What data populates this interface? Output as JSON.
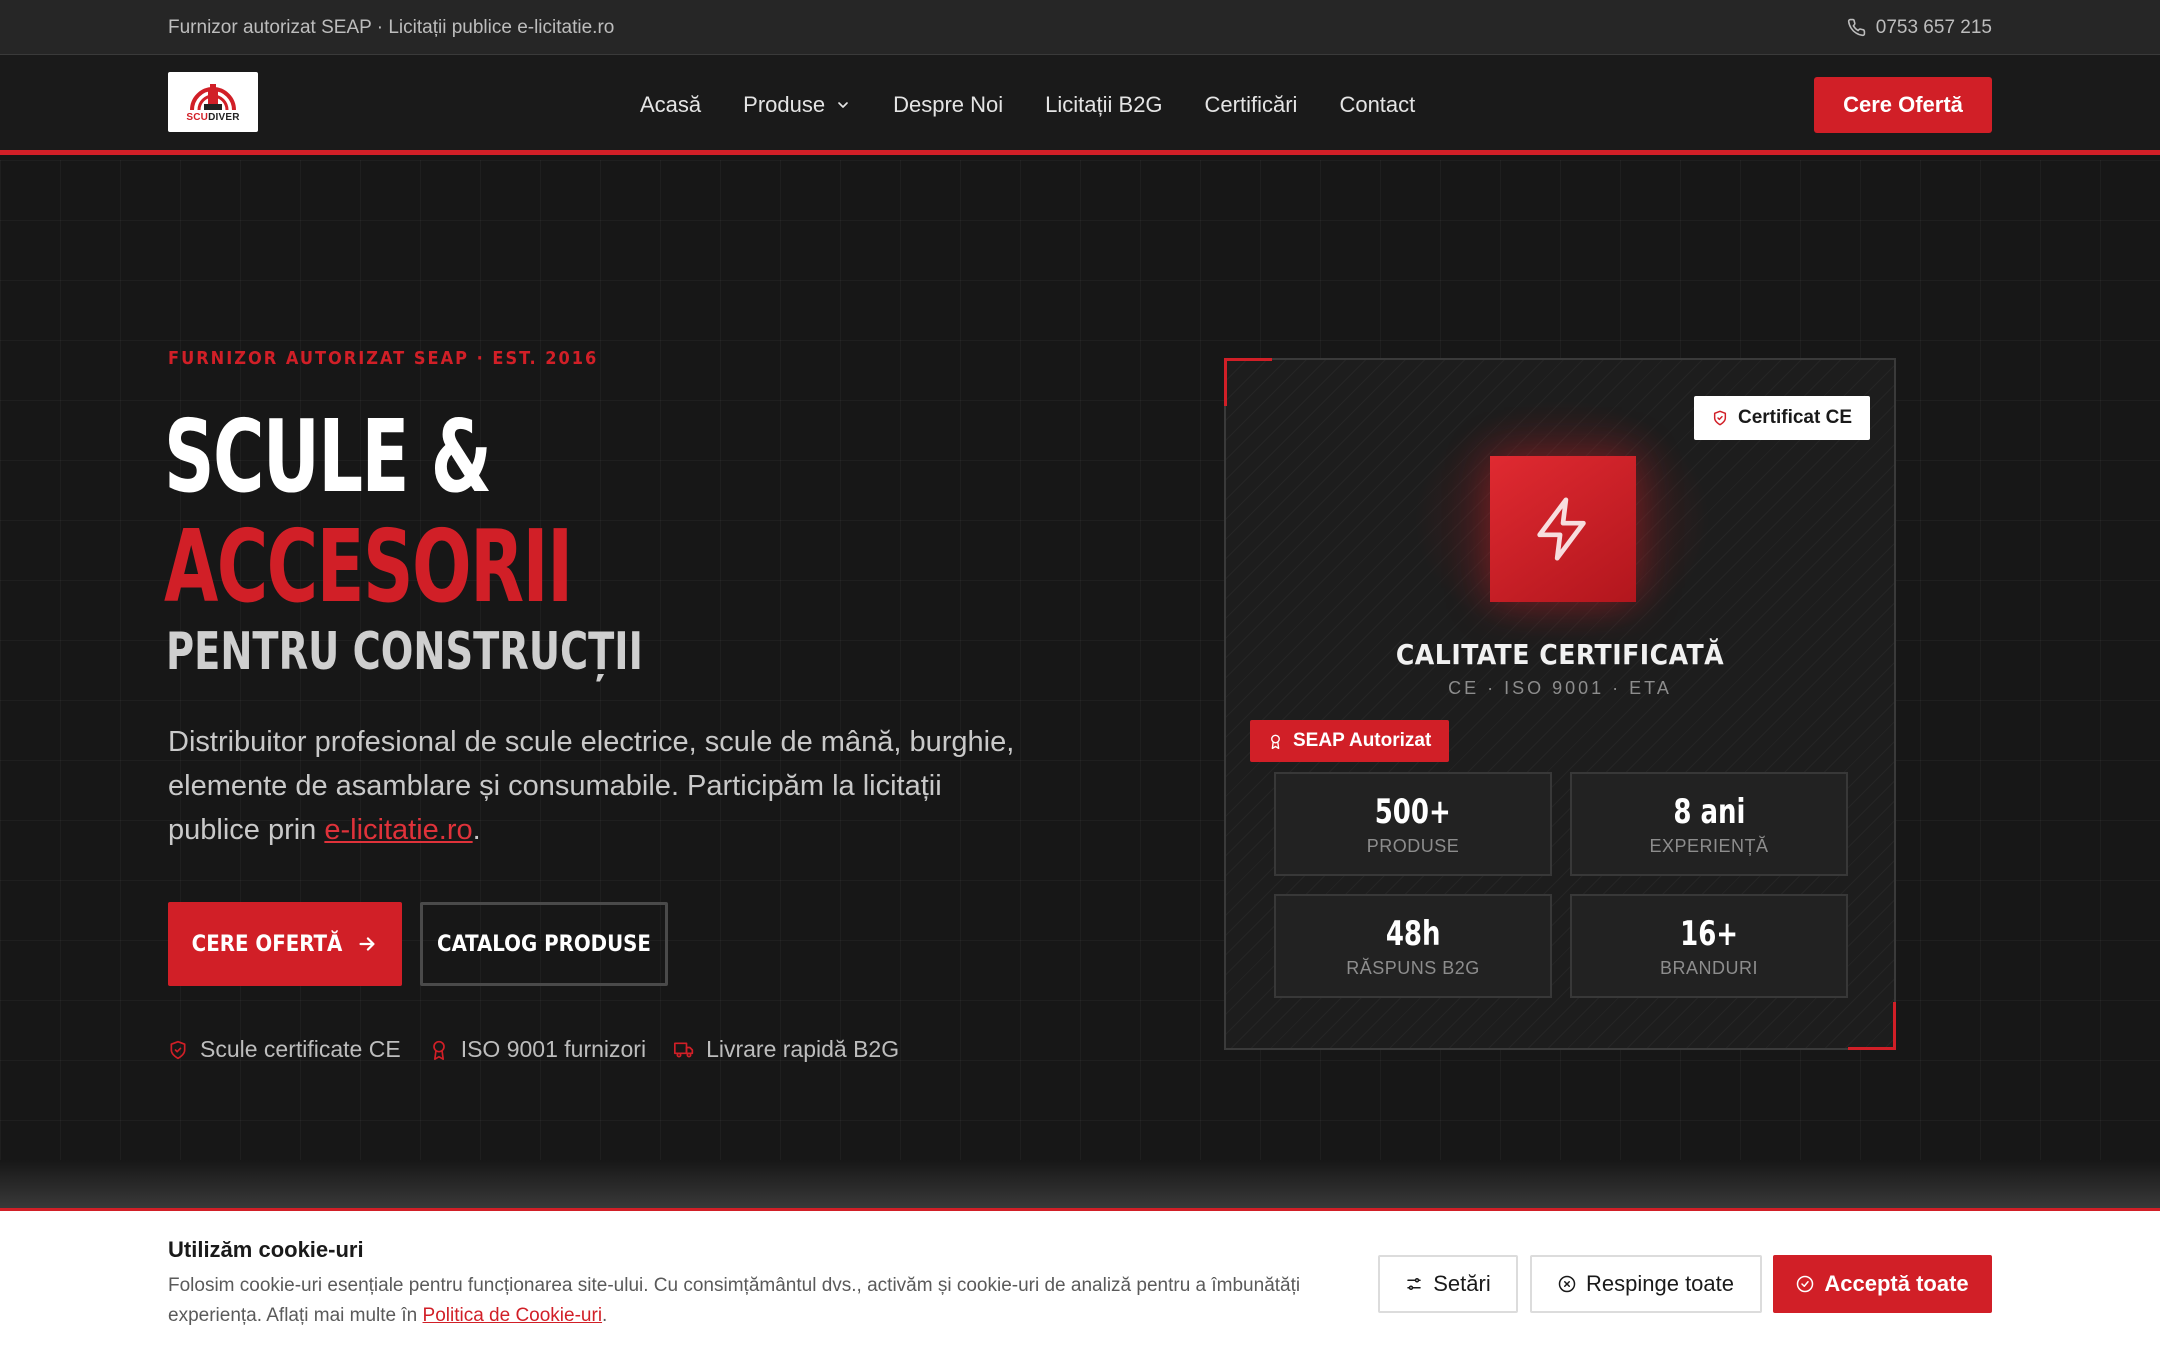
{
  "topbar": {
    "tagline": "Furnizor autorizat SEAP · Licitații publice e-licitatie.ro",
    "phone": "0753 657 215"
  },
  "logo": {
    "text_a": "SCU",
    "text_b": "DIVER"
  },
  "nav": {
    "items": [
      {
        "label": "Acasă"
      },
      {
        "label": "Produse"
      },
      {
        "label": "Despre Noi"
      },
      {
        "label": "Licitații B2G"
      },
      {
        "label": "Certificări"
      },
      {
        "label": "Contact"
      }
    ],
    "cta": "Cere Ofertă"
  },
  "hero": {
    "eyebrow": "FURNIZOR AUTORIZAT SEAP · EST. 2016",
    "title_line1": "SCULE &",
    "title_line2": "ACCESORII",
    "title_line3": "PENTRU CONSTRUCȚII",
    "lead_text": "Distribuitor profesional de scule electrice, scule de mână, burghie, elemente de asamblare și consumabile. Participăm la licitații publice prin ",
    "lead_link": "e-licitatie.ro",
    "lead_end": ".",
    "btn_primary": "CERE OFERTĂ",
    "btn_secondary": "CATALOG PRODUSE",
    "features": [
      {
        "label": "Scule certificate CE",
        "icon": "shield-check-icon"
      },
      {
        "label": "ISO 9001 furnizori",
        "icon": "award-icon"
      },
      {
        "label": "Livrare rapidă B2G",
        "icon": "truck-icon"
      }
    ]
  },
  "card": {
    "badge_top": "Certificat CE",
    "title": "CALITATE CERTIFICATĂ",
    "subtitle": "CE · ISO 9001 · ETA",
    "badge_seap": "SEAP Autorizat",
    "stats": [
      {
        "value": "500+",
        "label": "PRODUSE"
      },
      {
        "value": "8 ani",
        "label": "EXPERIENȚĂ"
      },
      {
        "value": "48h",
        "label": "RĂSPUNS B2G"
      },
      {
        "value": "16+",
        "label": "BRANDURI"
      }
    ]
  },
  "cookie": {
    "title": "Utilizăm cookie-uri",
    "text": "Folosim cookie-uri esențiale pentru funcționarea site-ului. Cu consimțământul dvs., activăm și cookie-uri de analiză pentru a îmbunătăți experiența. Aflați mai multe în ",
    "link": "Politica de Cookie-uri",
    "text_end": ".",
    "btn_settings": "Setări",
    "btn_reject": "Respinge toate",
    "btn_accept": "Acceptă toate"
  },
  "colors": {
    "accent": "#d11f27",
    "background": "#171717",
    "topbar": "#262626"
  }
}
